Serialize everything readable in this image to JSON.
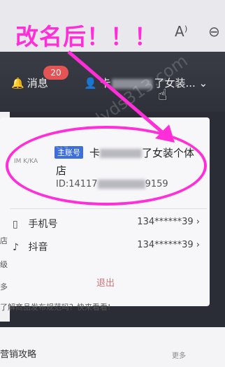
{
  "annotation": {
    "text": "改名后！！！",
    "color": "#ff2ed8"
  },
  "browser": {
    "read_aloud_icon": "A-speaker",
    "zoom_icon": "magnifier"
  },
  "header": {
    "messages_label": "消息",
    "messages_badge": "20",
    "account_prefix": "卡",
    "account_suffix": "了女装...",
    "chevron": "⌄"
  },
  "account_card": {
    "tag": "主账号",
    "shop_name_prefix": "卡",
    "shop_name_suffix": "了女装个体",
    "shop_name_line2": "店",
    "id_prefix": "ID:14117",
    "id_suffix": "9159",
    "icon_label": "IM K/KA"
  },
  "bindings": [
    {
      "label": "手机号",
      "value": "134******39"
    },
    {
      "label": "抖音",
      "value": "134******39"
    }
  ],
  "logout_label": "退出",
  "promo_text": "了解商品发布规范吗？快来看看!",
  "bottom": {
    "title": "营销攻略",
    "more": "更多"
  },
  "side_letters": [
    "店",
    "级",
    "多"
  ],
  "watermark": "www.dyds313.com"
}
